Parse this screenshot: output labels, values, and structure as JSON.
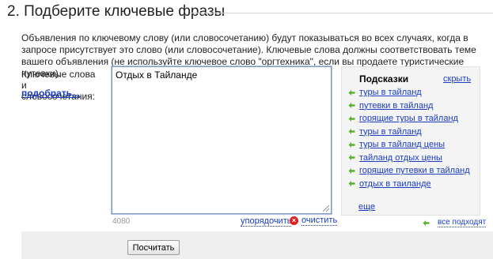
{
  "section": {
    "title": "2. Подберите ключевые фразы",
    "intro": "Объявления по ключевому слову (или словосочетанию) будут показываться во всех случаях, когда в запросе присутствует это слово (или словосочетание). Ключевые слова должны соответствовать теме вашего объявления (не используйте ключевое слово \"оргтехника\", если вы продаете туристические путевки)."
  },
  "keywords": {
    "label": "Ключевые слова и словосочетания:",
    "pick_link": "подобрать...",
    "value": "Отдых в Тайланде",
    "counter": "4080",
    "sort_link": "упорядочить",
    "clear_link": "очистить",
    "clear_icon": "close-circle-icon"
  },
  "hints": {
    "title": "Подсказки",
    "hide_link": "скрыть",
    "arrow_icon": "green-left-arrow-icon",
    "arrow_color": "#5bb12f",
    "items": [
      "туры в тайланд",
      "путевки в тайланд",
      "горящие туры в тайланд",
      "туры в тайланд",
      "туры в тайланд цены",
      "тайланд отдых цены",
      "горящие путевки в тайланд",
      "отдых в таиланде"
    ],
    "more_link": "еще",
    "all_fit_link": "все подходят"
  },
  "footer": {
    "calc_button": "Посчитать"
  },
  "colors": {
    "link": "#1a3dc1",
    "clear_icon": "#e02020",
    "hints_bg": "#f4f4f4",
    "footer_bg": "#efefef"
  }
}
